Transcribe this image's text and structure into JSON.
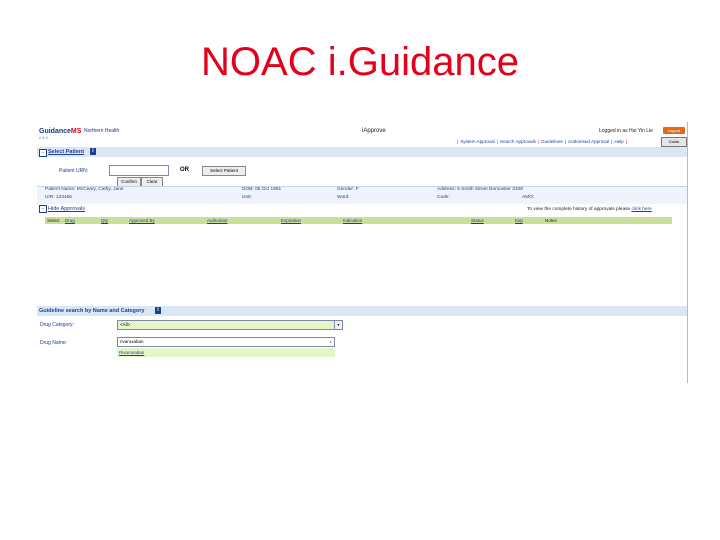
{
  "slide": {
    "title": "NOAC i.Guidance"
  },
  "app": {
    "logo_main": "Guidance",
    "logo_accent": "MS",
    "version": "v 2.4",
    "organisation": "Northern Health",
    "module": "iApprove",
    "logged_in": "Logged in as Hui Yin Lie",
    "logout_label": "Logout",
    "guide_label": "Guide",
    "nav_links": [
      "System Approval",
      "Search Approvals",
      "Guidelines",
      "Authorised Approval",
      "Help"
    ]
  },
  "select_patient": {
    "title": "Select Patient",
    "urn_label": "Patient URN:",
    "urn_value": "",
    "or_label": "OR",
    "select_button": "Select Patient",
    "confirm_button": "Confirm",
    "clear_button": "Clear"
  },
  "patient": {
    "name_label": "Patient Name:",
    "name": "McCeary, Cathy, Jane",
    "dob_label": "DOB:",
    "dob": "05 Oct 1981",
    "gender_label": "Gender:",
    "gender": "F",
    "address_label": "Address:",
    "address": "5 Smith Street Doncaster 3108",
    "ur_label": "U/R:",
    "ur": "123456",
    "unit_label": "Unit:",
    "unit": "",
    "ward_label": "Ward:",
    "ward": "",
    "code_label": "Code:",
    "code": "",
    "amo_label": "AMO:",
    "amo": ""
  },
  "approvals": {
    "hide_label": "Hide Approvals",
    "history_text": "To view the complete history of approvals please",
    "history_link": "click here",
    "columns": [
      "Select",
      "Drug",
      "Qty",
      "Approved By",
      "Authoriser",
      "Expiration",
      "Indication",
      "Status",
      "Exp",
      "Notes"
    ]
  },
  "guideline_search": {
    "title": "Guideline search by Name and Category",
    "category_label": "Drug Category:",
    "category_value": "<All>",
    "name_label": "Drug Name:",
    "name_value": "rivaroxaban",
    "suggestion": "Rivaroxaban"
  }
}
